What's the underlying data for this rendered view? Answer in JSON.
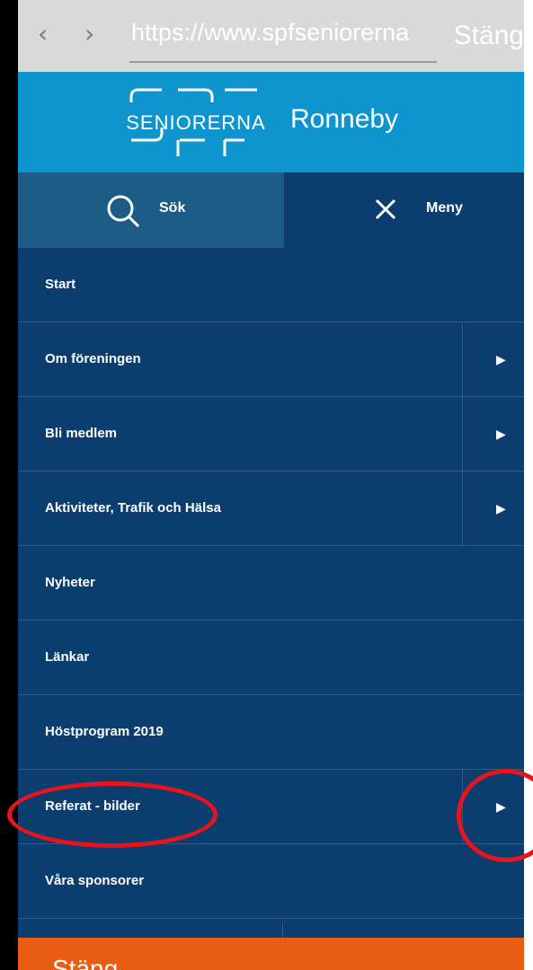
{
  "browser": {
    "back_icon": "chevron-left-icon",
    "back_glyph": "‹",
    "forward_icon": "chevron-right-icon",
    "forward_glyph": "›",
    "url": "https://www.spfseniorerna",
    "close_label": "Stäng"
  },
  "header": {
    "logo_text": "SENIORERNA",
    "site_name": "Ronneby",
    "color": "#0e95cd"
  },
  "toolbar": {
    "search_label": "Sök",
    "search_icon": "search-icon",
    "menu_label": "Meny",
    "menu_icon": "close-icon"
  },
  "menu": {
    "items": [
      {
        "label": "Start",
        "has_submenu": false
      },
      {
        "label": "Om föreningen",
        "has_submenu": true
      },
      {
        "label": "Bli medlem",
        "has_submenu": true
      },
      {
        "label": "Aktiviteter, Trafik och Hälsa",
        "has_submenu": true
      },
      {
        "label": "Nyheter",
        "has_submenu": false
      },
      {
        "label": "Länkar",
        "has_submenu": false
      },
      {
        "label": "Höstprogram 2019",
        "has_submenu": false
      },
      {
        "label": "Referat - bilder",
        "has_submenu": true
      },
      {
        "label": "Våra sponsorer",
        "has_submenu": false
      }
    ],
    "arrow_glyph": "▶",
    "background": "#0b3e6e"
  },
  "close_bar": {
    "label": "Stäng",
    "color": "#e85c14"
  },
  "annotation_color": "#e8131b"
}
